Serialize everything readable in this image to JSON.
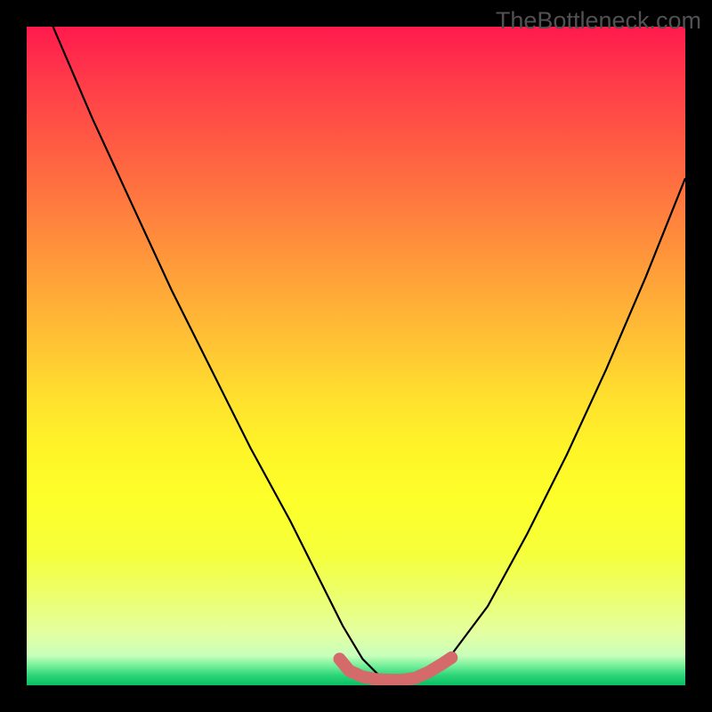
{
  "watermark": "TheBottleneck.com",
  "chart_data": {
    "type": "line",
    "title": "",
    "xlabel": "",
    "ylabel": "",
    "xlim": [
      0,
      100
    ],
    "ylim": [
      0,
      100
    ],
    "series": [
      {
        "name": "main-curve",
        "x": [
          4,
          10,
          16,
          22,
          28,
          34,
          40,
          44,
          48,
          51,
          54,
          57,
          60,
          64,
          70,
          76,
          82,
          88,
          94,
          100
        ],
        "y": [
          100,
          86,
          73,
          60,
          48,
          36,
          25,
          17,
          9,
          4,
          1,
          0.5,
          1,
          4,
          12,
          23,
          35,
          48,
          62,
          77
        ]
      },
      {
        "name": "valley-marker",
        "x": [
          47.5,
          49,
          51,
          53,
          55,
          57,
          59,
          61,
          63,
          64.5
        ],
        "y": [
          4,
          2.2,
          1.3,
          0.9,
          0.8,
          0.8,
          1.1,
          2.0,
          3.2,
          4.2
        ]
      }
    ],
    "annotations": []
  }
}
